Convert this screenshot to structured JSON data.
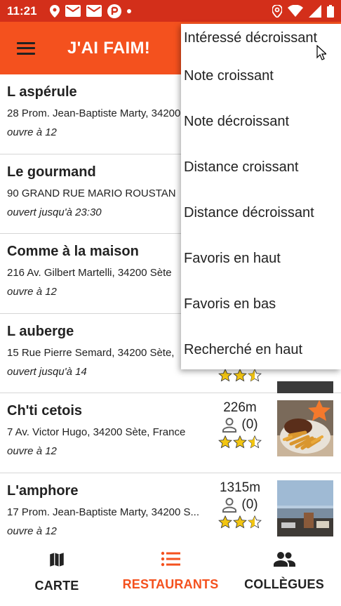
{
  "status_bar": {
    "time": "11:21",
    "icons_left": [
      "location-icon",
      "mail-icon",
      "mail-icon",
      "app-icon",
      "dot-icon"
    ],
    "icons_right": [
      "location-icon",
      "wifi-icon",
      "signal-icon",
      "battery-icon"
    ]
  },
  "app_bar": {
    "title": "J'AI FAIM!",
    "menu_icon": "hamburger-icon",
    "color": "#f4511e"
  },
  "restaurants": [
    {
      "name": "L aspérule",
      "address": "28 Prom. Jean-Baptiste Marty, 34200",
      "hours": "ouvre à 12"
    },
    {
      "name": "Le gourmand",
      "address": "90 GRAND RUE MARIO ROUSTAN",
      "hours": "ouvert jusqu'à 23:30"
    },
    {
      "name": "Comme à la maison",
      "address": "216 Av. Gilbert Martelli, 34200 Sète",
      "hours": "ouvre à 12"
    },
    {
      "name": "L auberge",
      "address": "15 Rue Pierre Semard, 34200 Sète,",
      "hours": "ouvert jusqu'à 14",
      "rating": 2.5
    },
    {
      "name": "Ch'ti cetois",
      "address": "7 Av. Victor Hugo, 34200 Sète, France",
      "hours": "ouvre à 12",
      "distance": "226m",
      "interested": "(0)",
      "rating": 2.5,
      "favorite": true
    },
    {
      "name": "L'amphore",
      "address": "17 Prom. Jean-Baptiste Marty, 34200 S...",
      "hours": "ouvre à 12",
      "distance": "1315m",
      "interested": "(0)",
      "rating": 2.5
    }
  ],
  "sort_menu": {
    "items": [
      "Intéressé décroissant",
      "Note croissant",
      "Note décroissant",
      "Distance croissant",
      "Distance décroissant",
      "Favoris en haut",
      "Favoris en bas",
      "Recherché en haut"
    ]
  },
  "bottom_nav": {
    "items": [
      {
        "label": "CARTE",
        "icon": "map-icon"
      },
      {
        "label": "RESTAURANTS",
        "icon": "list-icon",
        "active": true
      },
      {
        "label": "COLLÈGUES",
        "icon": "people-icon"
      }
    ],
    "active_color": "#f4511e"
  }
}
